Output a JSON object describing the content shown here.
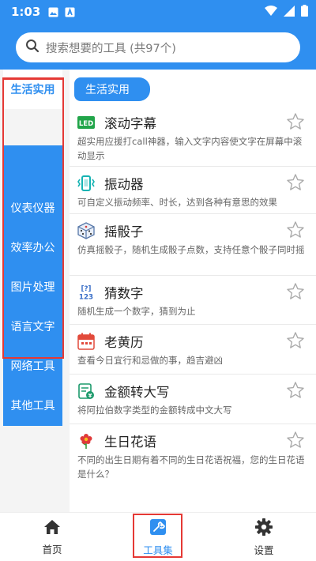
{
  "status_bar": {
    "time": "1:03"
  },
  "search": {
    "placeholder": "搜索想要的工具 (共97个)"
  },
  "sidebar": {
    "items": [
      {
        "label": "生活实用",
        "active": true
      },
      {
        "label": "仪表仪器"
      },
      {
        "label": "效率办公"
      },
      {
        "label": "图片处理"
      },
      {
        "label": "语言文字"
      },
      {
        "label": "网络工具"
      },
      {
        "label": "其他工具"
      }
    ]
  },
  "content": {
    "category_tag": "生活实用",
    "tools": [
      {
        "name": "滚动字幕",
        "desc": "超实用应援打call神器，输入文字内容使文字在屏幕中滚动显示",
        "icon": "led-icon",
        "icon_text": "LED"
      },
      {
        "name": "振动器",
        "desc": "可自定义振动频率、时长，达到各种有意思的效果",
        "icon": "vibrate-icon"
      },
      {
        "name": "摇骰子",
        "desc": "仿真摇骰子，随机生成骰子点数，支持任意个骰子同时摇",
        "icon": "dice-icon"
      },
      {
        "name": "猜数字",
        "desc": "随机生成一个数字，猜到为止",
        "icon": "number-guess-icon",
        "icon_text": "[?]\n123"
      },
      {
        "name": "老黄历",
        "desc": "查看今日宜行和忌做的事，趋吉避凶",
        "icon": "calendar-icon"
      },
      {
        "name": "金额转大写",
        "desc": "将阿拉伯数字类型的金额转成中文大写",
        "icon": "money-icon"
      },
      {
        "name": "生日花语",
        "desc": "不同的出生日期有着不同的生日花语祝福，您的生日花语是什么？",
        "icon": "flower-icon"
      }
    ]
  },
  "bottom_nav": {
    "items": [
      {
        "label": "首页",
        "icon": "home-icon"
      },
      {
        "label": "工具集",
        "icon": "toolbox-icon",
        "active": true
      },
      {
        "label": "设置",
        "icon": "gear-icon"
      }
    ]
  },
  "colors": {
    "primary": "#2f8ff0",
    "highlight_outline": "#e53935"
  }
}
